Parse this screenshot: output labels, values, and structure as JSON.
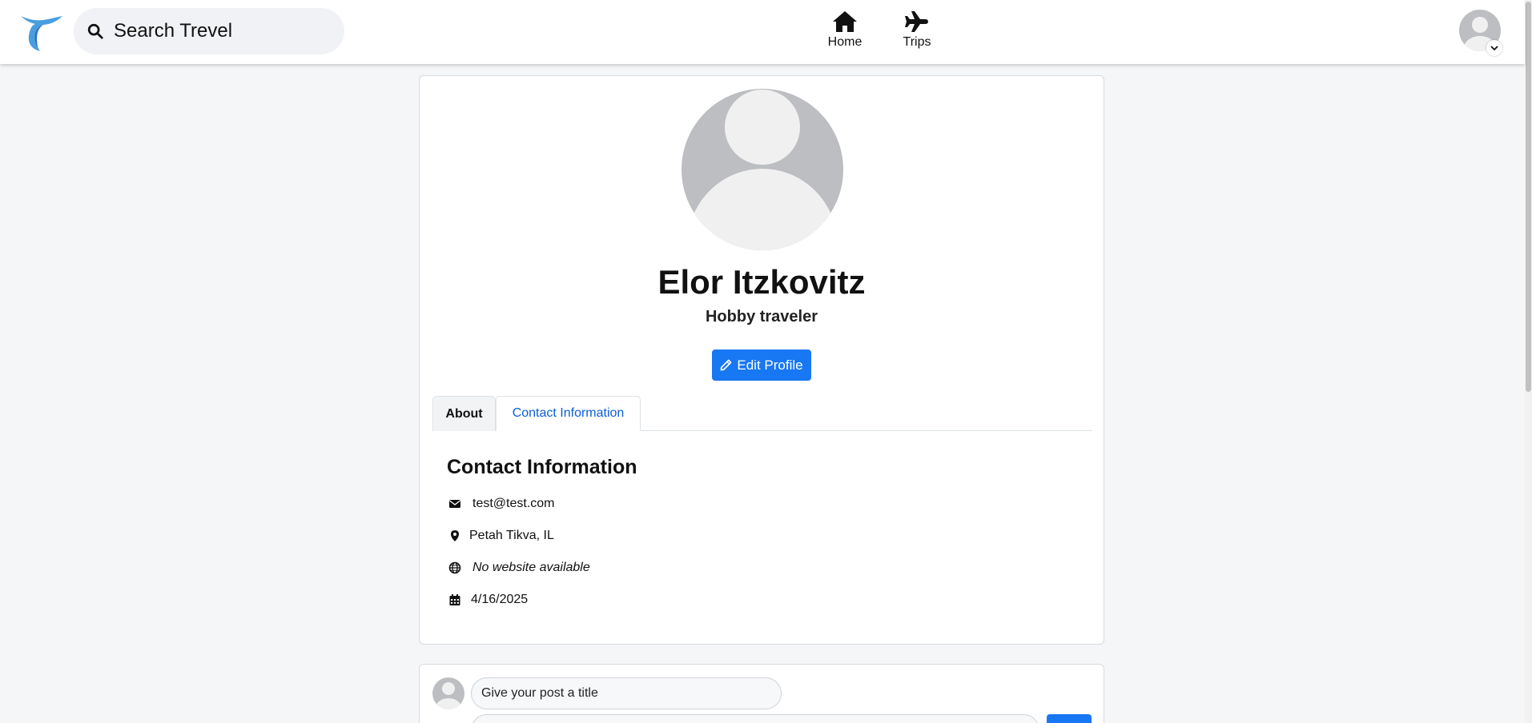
{
  "search": {
    "placeholder": "Search Trevel"
  },
  "nav": {
    "home_label": "Home",
    "trips_label": "Trips"
  },
  "profile": {
    "name": "Elor Itzkovitz",
    "role": "Hobby traveler",
    "edit_label": "Edit Profile"
  },
  "tabs": {
    "about_label": "About",
    "contact_label": "Contact Information"
  },
  "contact": {
    "heading": "Contact Information",
    "email": "test@test.com",
    "location": "Petah Tikva, IL",
    "website": "No website available",
    "date": "4/16/2025"
  },
  "composer": {
    "title_placeholder": "Give your post a title"
  },
  "colors": {
    "accent": "#1877f2",
    "tab_active_text": "#0b5ed7",
    "logo_blue": "#4a9ee0"
  },
  "icons": [
    "logo-icon",
    "search-icon",
    "home-icon",
    "plane-icon",
    "avatar-icon",
    "chevron-down-icon",
    "pencil-icon",
    "envelope-icon",
    "map-pin-icon",
    "globe-icon",
    "calendar-icon"
  ]
}
